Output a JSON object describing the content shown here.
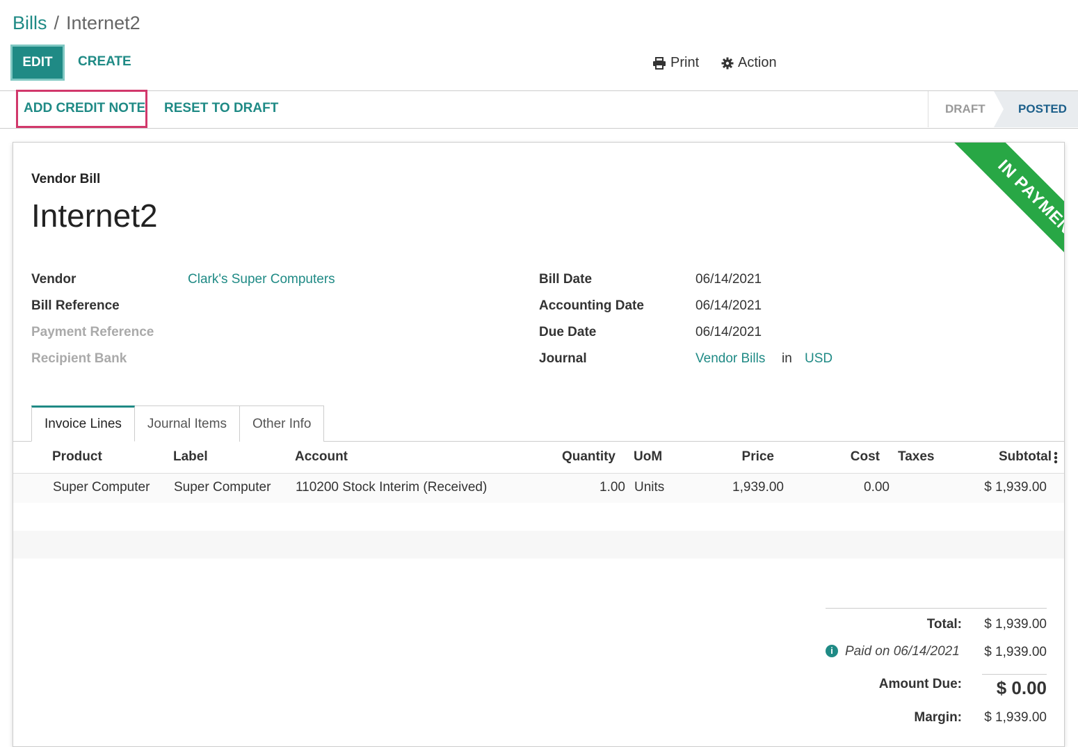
{
  "breadcrumb": {
    "parent": "Bills",
    "separator": "/",
    "current": "Internet2"
  },
  "control_panel": {
    "edit_label": "EDIT",
    "create_label": "CREATE",
    "print_label": "Print",
    "action_label": "Action"
  },
  "statusbar": {
    "buttons": {
      "credit_note": "ADD CREDIT NOTE",
      "reset": "RESET TO DRAFT"
    },
    "stages": {
      "draft": "DRAFT",
      "posted": "POSTED"
    }
  },
  "sheet": {
    "ribbon": "IN PAYMENT",
    "doc_type": "Vendor Bill",
    "doc_name": "Internet2",
    "left_fields": {
      "vendor_label": "Vendor",
      "vendor_value": "Clark's Super Computers",
      "bill_ref_label": "Bill Reference",
      "payment_ref_label": "Payment Reference",
      "recipient_bank_label": "Recipient Bank"
    },
    "right_fields": {
      "bill_date_label": "Bill Date",
      "bill_date_value": "06/14/2021",
      "accounting_date_label": "Accounting Date",
      "accounting_date_value": "06/14/2021",
      "due_date_label": "Due Date",
      "due_date_value": "06/14/2021",
      "journal_label": "Journal",
      "journal_value": "Vendor Bills",
      "journal_in": "in",
      "currency": "USD"
    },
    "tabs": [
      "Invoice Lines",
      "Journal Items",
      "Other Info"
    ],
    "table": {
      "headers": {
        "product": "Product",
        "label": "Label",
        "account": "Account",
        "quantity": "Quantity",
        "uom": "UoM",
        "price": "Price",
        "cost": "Cost",
        "taxes": "Taxes",
        "subtotal": "Subtotal"
      },
      "row": {
        "product": "Super Computer",
        "label": "Super Computer",
        "account": "110200 Stock Interim (Received)",
        "quantity": "1.00",
        "uom": "Units",
        "price": "1,939.00",
        "cost": "0.00",
        "taxes": "",
        "subtotal": "$ 1,939.00"
      }
    },
    "totals": {
      "total_label": "Total:",
      "total_value": "$ 1,939.00",
      "paid_label": "Paid on 06/14/2021",
      "paid_value": "$ 1,939.00",
      "amount_due_label": "Amount Due:",
      "amount_due_value": "$ 0.00",
      "margin_label": "Margin:",
      "margin_value": "$ 1,939.00"
    }
  }
}
